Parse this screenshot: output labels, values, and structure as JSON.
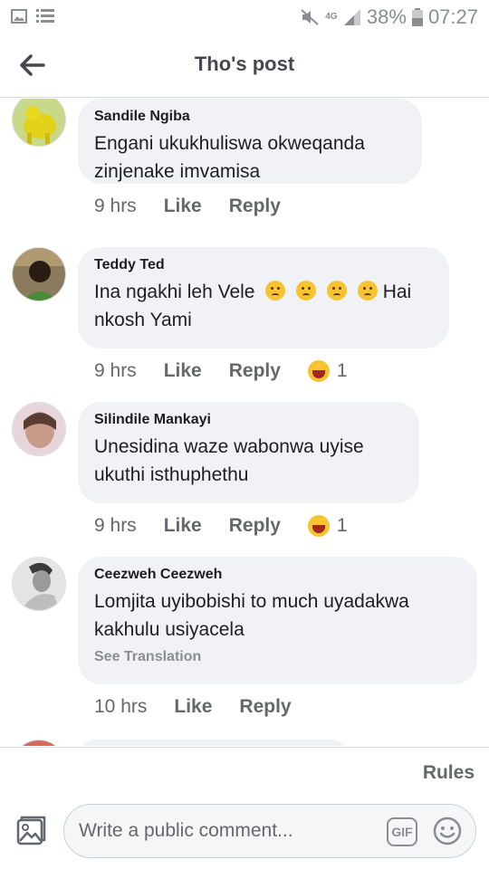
{
  "status_bar": {
    "network": "4G",
    "battery": "38%",
    "time": "07:27"
  },
  "header": {
    "title": "Tho's post"
  },
  "comments": [
    {
      "author": "Sandile Ngiba",
      "text": "Engani ukukhuliswa okweqanda zinjenake imvamisa",
      "time": "9 hrs",
      "like": "Like",
      "reply": "Reply",
      "reactions": null
    },
    {
      "author": "Teddy Ted",
      "text_before": "Ina ngakhi leh Vele",
      "text_after": "Hai nkosh Yami",
      "time": "9 hrs",
      "like": "Like",
      "reply": "Reply",
      "reactions": "1"
    },
    {
      "author": "Silindile Mankayi",
      "text": "Unesidina waze wabonwa uyise ukuthi isthuphethu",
      "time": "9 hrs",
      "like": "Like",
      "reply": "Reply",
      "reactions": "1"
    },
    {
      "author": "Ceezweh Ceezweh",
      "text": "Lomjita uyibobishi to much uyadakwa kakhulu usiyacela",
      "see_translation": "See Translation",
      "time": "10 hrs",
      "like": "Like",
      "reply": "Reply",
      "reactions": null
    }
  ],
  "rules": "Rules",
  "composer": {
    "placeholder": "Write a public comment...",
    "gif_label": "GIF"
  },
  "icons": {
    "back": "arrow-left-icon",
    "photo": "photo-icon",
    "emoji": "smiley-icon",
    "reaction": "haha-reaction-icon"
  }
}
